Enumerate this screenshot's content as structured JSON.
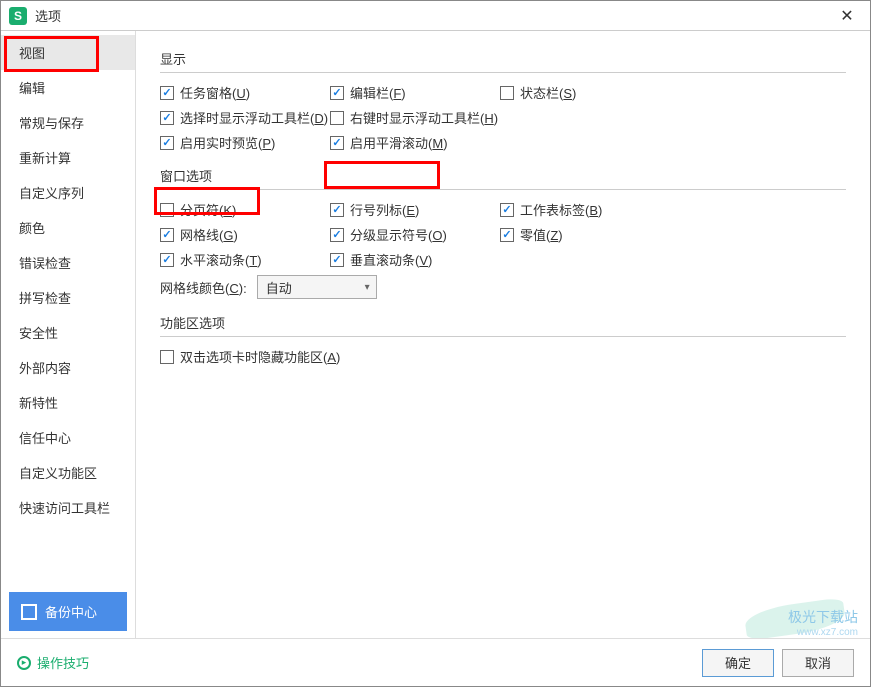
{
  "window": {
    "title": "选项"
  },
  "sidebar": {
    "items": [
      {
        "label": "视图",
        "active": true
      },
      {
        "label": "编辑"
      },
      {
        "label": "常规与保存"
      },
      {
        "label": "重新计算"
      },
      {
        "label": "自定义序列"
      },
      {
        "label": "颜色"
      },
      {
        "label": "错误检查"
      },
      {
        "label": "拼写检查"
      },
      {
        "label": "安全性"
      },
      {
        "label": "外部内容"
      },
      {
        "label": "新特性"
      },
      {
        "label": "信任中心"
      },
      {
        "label": "自定义功能区"
      },
      {
        "label": "快速访问工具栏"
      }
    ],
    "backup": "备份中心"
  },
  "sections": {
    "display": {
      "title": "显示",
      "task_pane": {
        "label": "任务窗格(",
        "hotkey": "U",
        "suffix": ")",
        "checked": true
      },
      "edit_bar": {
        "label": "编辑栏(",
        "hotkey": "F",
        "suffix": ")",
        "checked": true
      },
      "status_bar": {
        "label": "状态栏(",
        "hotkey": "S",
        "suffix": ")",
        "checked": false
      },
      "float_select": {
        "label": "选择时显示浮动工具栏(",
        "hotkey": "D",
        "suffix": ")",
        "checked": true
      },
      "float_right": {
        "label": "右键时显示浮动工具栏(",
        "hotkey": "H",
        "suffix": ")",
        "checked": false
      },
      "live_preview": {
        "label": "启用实时预览(",
        "hotkey": "P",
        "suffix": ")",
        "checked": true
      },
      "smooth_scroll": {
        "label": "启用平滑滚动(",
        "hotkey": "M",
        "suffix": ")",
        "checked": true
      }
    },
    "window": {
      "title": "窗口选项",
      "page_break": {
        "label": "分页符(",
        "hotkey": "K",
        "suffix": ")",
        "checked": false
      },
      "row_col": {
        "label": "行号列标(",
        "hotkey": "E",
        "suffix": ")",
        "checked": true
      },
      "sheet_tab": {
        "label": "工作表标签(",
        "hotkey": "B",
        "suffix": ")",
        "checked": true
      },
      "gridlines": {
        "label": "网格线(",
        "hotkey": "G",
        "suffix": ")",
        "checked": true
      },
      "outline": {
        "label": "分级显示符号(",
        "hotkey": "O",
        "suffix": ")",
        "checked": true
      },
      "zero": {
        "label": "零值(",
        "hotkey": "Z",
        "suffix": ")",
        "checked": true
      },
      "hscroll": {
        "label": "水平滚动条(",
        "hotkey": "T",
        "suffix": ")",
        "checked": true
      },
      "vscroll": {
        "label": "垂直滚动条(",
        "hotkey": "V",
        "suffix": ")",
        "checked": true
      },
      "grid_color_label": "网格线颜色(",
      "grid_color_hotkey": "C",
      "grid_color_suffix": "):",
      "grid_color_value": "自动"
    },
    "ribbon": {
      "title": "功能区选项",
      "hide_dbl": {
        "label": "双击选项卡时隐藏功能区(",
        "hotkey": "A",
        "suffix": ")",
        "checked": false
      }
    }
  },
  "footer": {
    "tips": "操作技巧",
    "ok": "确定",
    "cancel": "取消"
  },
  "watermark": {
    "line1": "极光下载站",
    "line2": "www.xz7.com"
  }
}
